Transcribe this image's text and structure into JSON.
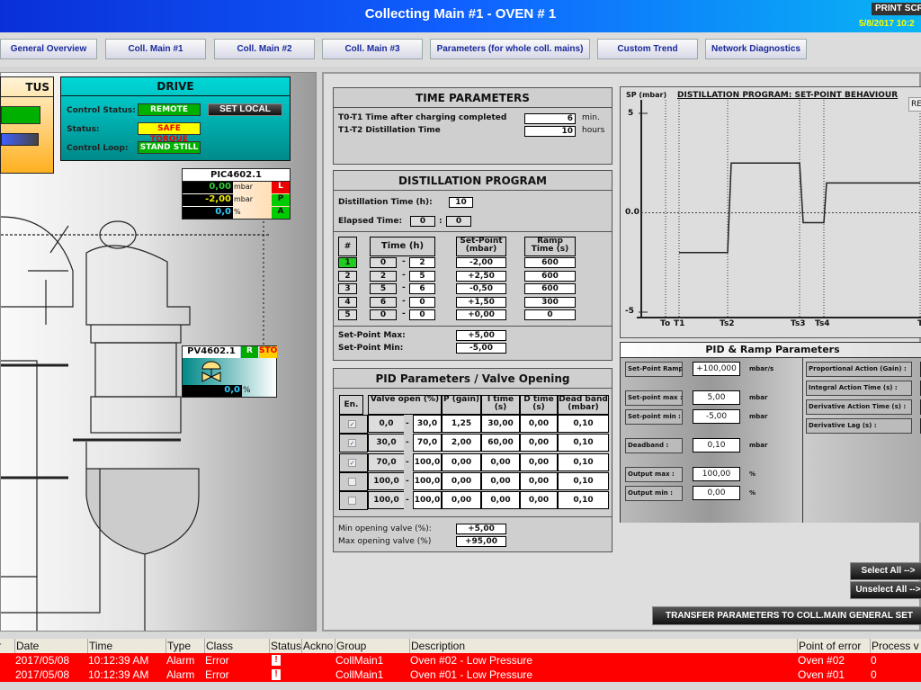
{
  "header": {
    "title": "Collecting Main #1 - OVEN # 1",
    "print_label": "PRINT SCR",
    "datetime": "5/8/2017 10:2"
  },
  "nav": [
    {
      "label": "General Overview"
    },
    {
      "label": "Coll. Main #1"
    },
    {
      "label": "Coll. Main #2"
    },
    {
      "label": "Coll. Main #3"
    },
    {
      "label": "Parameters (for whole coll. mains)"
    },
    {
      "label": "Custom Trend"
    },
    {
      "label": "Network Diagnostics"
    }
  ],
  "status_panel": {
    "title": "TUS"
  },
  "drive": {
    "title": "DRIVE",
    "control_status_label": "Control Status:",
    "control_status": "REMOTE",
    "set_local": "SET LOCAL",
    "status_label": "Status:",
    "status": "SAFE TORQUE",
    "loop_label": "Control Loop:",
    "loop": "STAND STILL"
  },
  "pic": {
    "tag": "PIC4602.1",
    "pv": "0,00",
    "sp": "-2,00",
    "out": "0,0",
    "unit_pv": "mbar",
    "unit_sp": "mbar",
    "unit_out": "%",
    "flags": [
      "L",
      "P",
      "A"
    ]
  },
  "pv": {
    "tag": "PV4602.1",
    "flag_r": "R",
    "flag_sto": "STO",
    "value": "0,0",
    "unit": "%"
  },
  "time_params": {
    "title": "TIME PARAMETERS",
    "rows": [
      {
        "label": "T0-T1 Time after charging completed",
        "value": "6",
        "unit": "min."
      },
      {
        "label": "T1-T2 Distillation Time",
        "value": "10",
        "unit": "hours"
      }
    ]
  },
  "distillation": {
    "title": "DISTILLATION PROGRAM",
    "dist_time_label": "Distillation Time (h):",
    "dist_time": "10",
    "elapsed_label": "Elapsed Time:",
    "elapsed_h": "0",
    "elapsed_sep": ":",
    "elapsed_m": "0",
    "headers": [
      "#",
      "Time (h)",
      "Set-Point (mbar)",
      "Ramp Time (s)"
    ],
    "rows": [
      {
        "n": "1",
        "from": "0",
        "to": "2",
        "sp": "-2,00",
        "ramp": "600",
        "active": true
      },
      {
        "n": "2",
        "from": "2",
        "to": "5",
        "sp": "+2,50",
        "ramp": "600"
      },
      {
        "n": "3",
        "from": "5",
        "to": "6",
        "sp": "-0,50",
        "ramp": "600"
      },
      {
        "n": "4",
        "from": "6",
        "to": "0",
        "sp": "+1,50",
        "ramp": "300"
      },
      {
        "n": "5",
        "from": "0",
        "to": "0",
        "sp": "+0,00",
        "ramp": "0"
      }
    ],
    "sp_max_label": "Set-Point Max:",
    "sp_max": "+5,00",
    "sp_min_label": "Set-Point Min:",
    "sp_min": "-5,00"
  },
  "pid": {
    "title": "PID Parameters / Valve Opening",
    "headers": [
      "En.",
      "Valve open (%)",
      "P (gain)",
      "I time (s)",
      "D time (s)",
      "Dead band (mbar)"
    ],
    "rows": [
      {
        "en": true,
        "from": "0,0",
        "to": "30,0",
        "p": "1,25",
        "i": "30,00",
        "d": "0,00",
        "db": "0,10"
      },
      {
        "en": true,
        "from": "30,0",
        "to": "70,0",
        "p": "2,00",
        "i": "60,00",
        "d": "0,00",
        "db": "0,10"
      },
      {
        "en": true,
        "from": "70,0",
        "to": "100,0",
        "p": "0,00",
        "i": "0,00",
        "d": "0,00",
        "db": "0,10"
      },
      {
        "en": false,
        "from": "100,0",
        "to": "100,0",
        "p": "0,00",
        "i": "0,00",
        "d": "0,00",
        "db": "0,10"
      },
      {
        "en": false,
        "from": "100,0",
        "to": "100,0",
        "p": "0,00",
        "i": "0,00",
        "d": "0,00",
        "db": "0,10"
      }
    ],
    "min_label": "Min opening valve (%):",
    "min": "+5,00",
    "max_label": "Max opening valve (%)",
    "max": "+95,00"
  },
  "chart": {
    "ylabel": "SP (mbar)",
    "title": "DISTILLATION PROGRAM: SET-POINT BEHAVIOUR",
    "button": "RE",
    "yticks": [
      "5",
      "0.0",
      "-5"
    ],
    "xticks": [
      "To",
      "T1",
      "Ts2",
      "Ts3",
      "Ts4",
      "T"
    ],
    "setpoints": [
      -2.0,
      2.5,
      -0.5,
      1.5
    ],
    "ylim": [
      -5,
      5
    ]
  },
  "pid_ramp": {
    "title": "PID & Ramp Parameters",
    "left": [
      {
        "label": "Set-Point Ramp :",
        "value": "+100,000",
        "unit": "mbar/s"
      },
      {
        "label": "Set-point max :",
        "value": "5,00",
        "unit": "mbar"
      },
      {
        "label": "Set-point min :",
        "value": "-5,00",
        "unit": "mbar"
      },
      {
        "label": "Deadband :",
        "value": "0,10",
        "unit": "mbar"
      },
      {
        "label": "Output max :",
        "value": "100,00",
        "unit": "%"
      },
      {
        "label": "Output min :",
        "value": "0,00",
        "unit": "%"
      }
    ],
    "right": [
      {
        "label": "Proportional Action  (Gain) :"
      },
      {
        "label": "Integral Action Time (s) :"
      },
      {
        "label": "Derivative Action Time (s) :"
      },
      {
        "label": "Derivative Lag (s) :"
      }
    ]
  },
  "buttons": {
    "select_all": "Select All -->",
    "unselect_all": "Unselect All -->",
    "transfer": "TRANSFER PARAMETERS TO COLL.MAIN GENERAL SET"
  },
  "alarms": {
    "headers": [
      "ber",
      "Date",
      "Time",
      "Type",
      "Class",
      "Status",
      "Ackno",
      "Group",
      "Description",
      "Point of error",
      "Process v"
    ],
    "rows": [
      [
        "",
        "2017/05/08",
        "10:12:39 AM",
        "Alarm",
        "Error",
        "!",
        "",
        "CollMain1",
        "Oven #02 - Low Pressure",
        "Oven #02",
        "0"
      ],
      [
        "",
        "2017/05/08",
        "10:12:39 AM",
        "Alarm",
        "Error",
        "!",
        "",
        "CollMain1",
        "Oven #01 - Low Pressure",
        "Oven #01",
        "0"
      ]
    ]
  },
  "colors": {
    "title_blue": "#0a2fd8",
    "alarm_red": "#ff0000",
    "ok_green": "#00b000",
    "drive_teal": "#00a8a8"
  }
}
